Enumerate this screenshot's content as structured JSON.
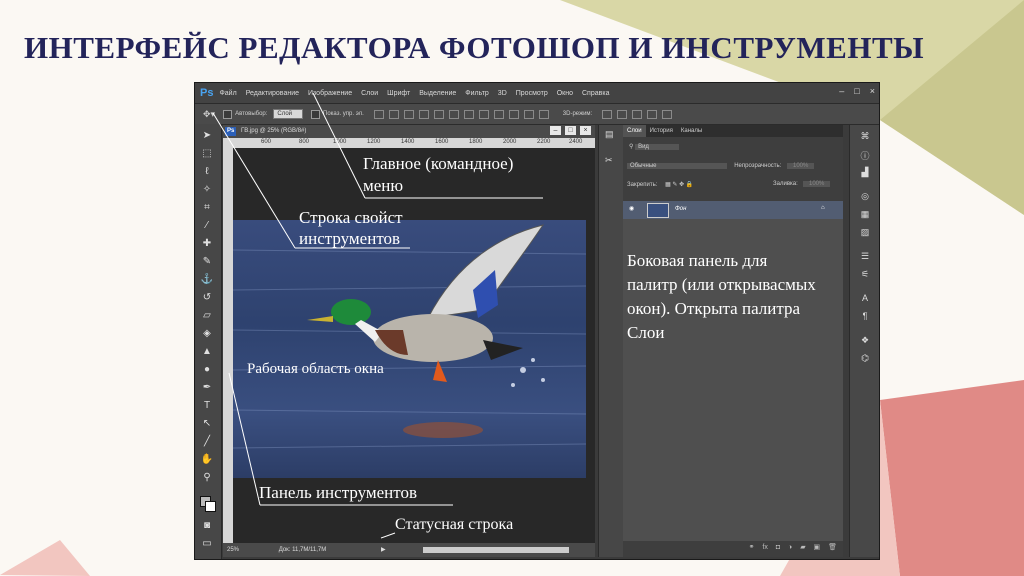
{
  "slide": {
    "title": "ИНТЕРФЕЙС РЕДАКТОРА ФОТОШОП И ИНСТРУМЕНТЫ",
    "colors": {
      "title": "#23245a",
      "olive": "#c9c78f",
      "rose": "#e08a86",
      "pink": "#f2c6c0",
      "background": "#fbf8f3"
    }
  },
  "photoshop": {
    "logo": "Ps",
    "menu": [
      "Файл",
      "Редактирование",
      "Изображение",
      "Слои",
      "Шрифт",
      "Выделение",
      "Фильтр",
      "3D",
      "Просмотр",
      "Окно",
      "Справка"
    ],
    "window_buttons": [
      "–",
      "□",
      "×"
    ],
    "options_bar": {
      "auto_select": "Автовыбор:",
      "layer_select": "Слой",
      "transform": "Показ. упр. эл.",
      "mode3d": "3D-режим:"
    },
    "doc_tab": {
      "icon": "Ps",
      "title": "ГВ.jpg @ 25% (RGB/8#)"
    },
    "ruler_ticks": [
      "600",
      "800",
      "1000",
      "1200",
      "1400",
      "1600",
      "1800",
      "2000",
      "2200",
      "2400"
    ],
    "status": {
      "zoom": "25%",
      "doc_info": "Док: 11,7M/11,7M"
    },
    "panel": {
      "tabs": [
        "Слои",
        "История",
        "Каналы"
      ],
      "kind": "Вид",
      "blend_mode": "Обычные",
      "opacity_label": "Непрозрачность:",
      "opacity_value": "100%",
      "lock_label": "Закрепить:",
      "fill_label": "Заливка:",
      "fill_value": "100%",
      "layer_name": "Фон"
    }
  },
  "annotations": {
    "main_menu_line1": "Главное (командное)",
    "main_menu_line2": "меню",
    "options_line1": "Строка свойст",
    "options_line2": "инструментов",
    "workspace": "Рабочая область окна",
    "tools": "Панель  инструментов",
    "statusbar": "Статусная строка",
    "side_panel": [
      "Боковая панель для",
      "палитр (или открывасмых",
      "окон). Открыта палитра",
      "Слои"
    ]
  }
}
